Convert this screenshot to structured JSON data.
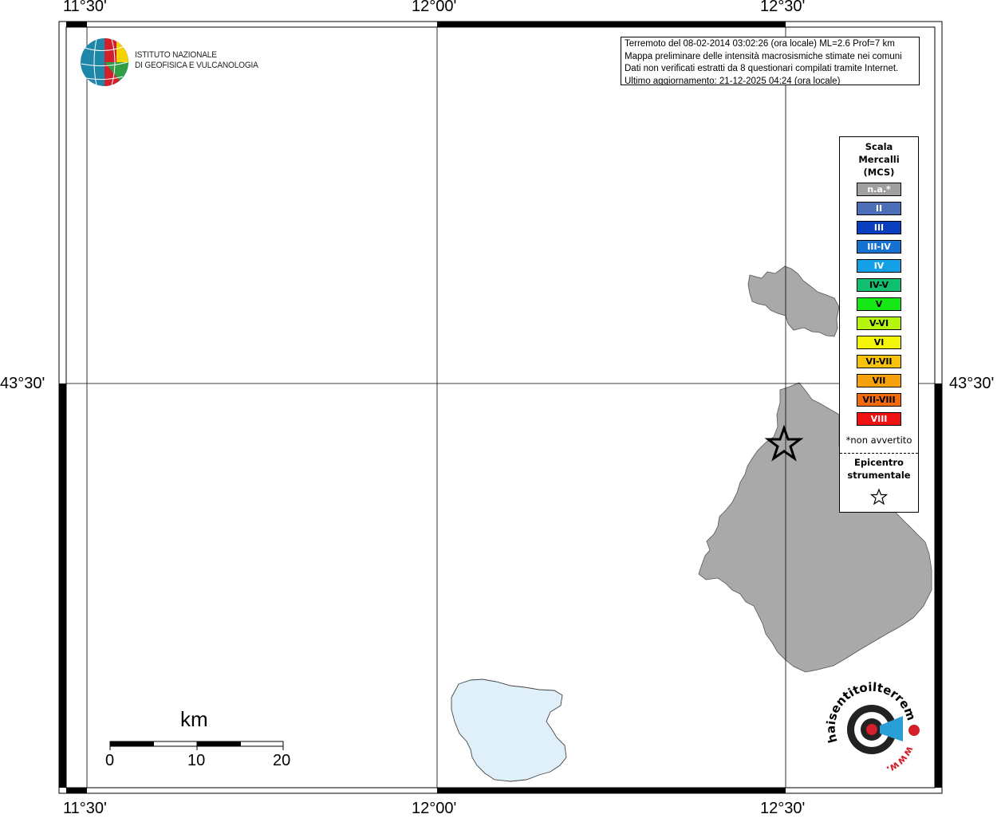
{
  "coords": {
    "top": [
      "11°30'",
      "12°00'",
      "12°30'"
    ],
    "bottom": [
      "11°30'",
      "12°00'",
      "12°30'"
    ],
    "left": "43°30'",
    "right": "43°30'"
  },
  "institute": {
    "line1": "ISTITUTO NAZIONALE",
    "line2": "DI GEOFISICA E VULCANOLOGIA"
  },
  "info": {
    "line1": "Terremoto del 08-02-2014 03:02:26 (ora locale) ML=2.6 Prof=7 km",
    "line2": "Mappa preliminare delle intensità macrosismiche stimate nei comuni",
    "line3": "Dati non verificati estratti da 8 questionari compilati tramite Internet.",
    "line4": "Ultimo aggiornamento: 21-12-2025 04:24 (ora locale)"
  },
  "legend": {
    "title1": "Scala",
    "title2": "Mercalli",
    "title3": "(MCS)",
    "items": [
      {
        "label": "n.a.*",
        "color": "#a0a0a0",
        "dark": false
      },
      {
        "label": "II",
        "color": "#4d6fb8",
        "dark": false
      },
      {
        "label": "III",
        "color": "#0a3fbf",
        "dark": false
      },
      {
        "label": "III-IV",
        "color": "#1672d0",
        "dark": false
      },
      {
        "label": "IV",
        "color": "#14a0e6",
        "dark": false
      },
      {
        "label": "IV-V",
        "color": "#10c070",
        "dark": true
      },
      {
        "label": "V",
        "color": "#16e816",
        "dark": true
      },
      {
        "label": "V-VI",
        "color": "#b5f50e",
        "dark": true
      },
      {
        "label": "VI",
        "color": "#f5f50a",
        "dark": true
      },
      {
        "label": "VI-VII",
        "color": "#f7c20c",
        "dark": true
      },
      {
        "label": "VII",
        "color": "#f7a20c",
        "dark": true
      },
      {
        "label": "VII-VIII",
        "color": "#f26a0c",
        "dark": true
      },
      {
        "label": "VIII",
        "color": "#f01212",
        "dark": false
      }
    ],
    "note": "*non avvertito",
    "epicenter1": "Epicentro",
    "epicenter2": "strumentale"
  },
  "scalebar": {
    "unit": "km",
    "ticks": [
      "0",
      "10",
      "20"
    ]
  },
  "haisentito": {
    "text": "haisentitoilterremoto",
    "domain": ".it",
    "prefix": "www."
  },
  "colors": {
    "municipality": "#a9a9a9",
    "lake": "#dff0fb",
    "border": "#000000"
  }
}
